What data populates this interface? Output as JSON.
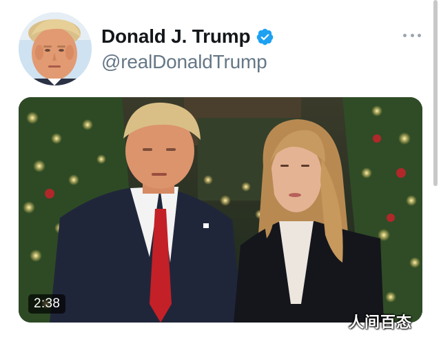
{
  "tweet": {
    "display_name": "Donald J. Trump",
    "handle": "@realDonaldTrump",
    "verified": true,
    "avatar_icon": "profile-photo",
    "more_icon": "more-options-icon"
  },
  "media": {
    "type": "video",
    "duration": "2:38"
  },
  "watermark": {
    "text": "人间百态"
  },
  "colors": {
    "name": "#14171a",
    "handle": "#657786",
    "verified": "#1da1f2",
    "more_dots": "#9aa5b0"
  }
}
